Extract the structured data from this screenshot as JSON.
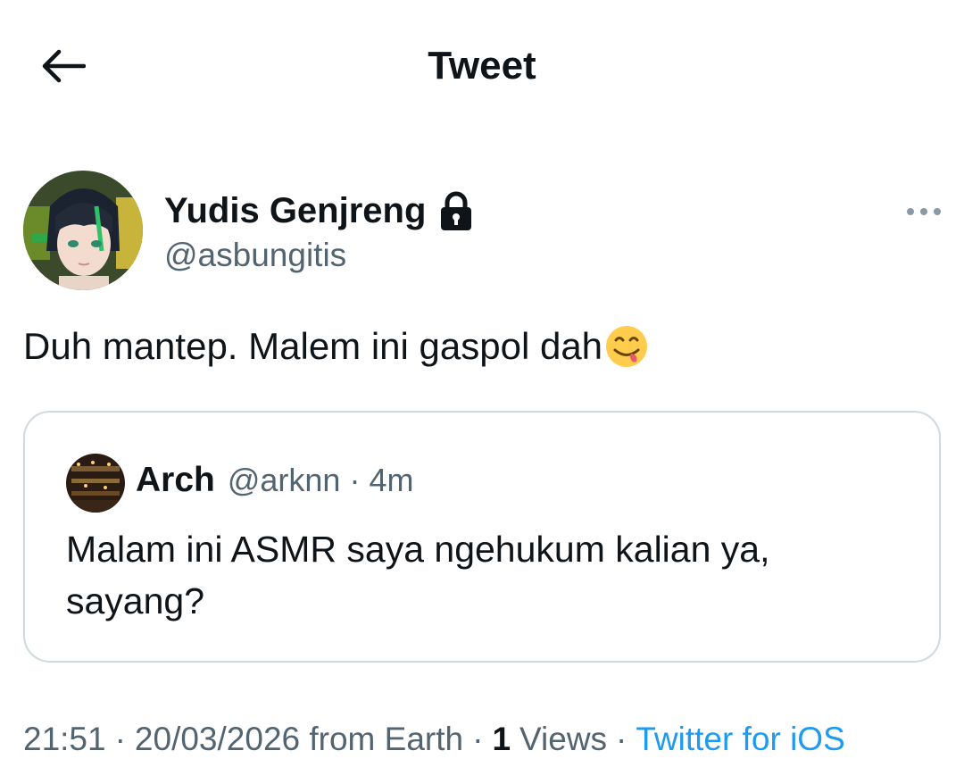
{
  "header": {
    "title": "Tweet",
    "back_icon": "arrow-left-icon"
  },
  "author": {
    "display_name": "Yudis Genjreng",
    "handle": "@asbungitis",
    "protected_icon": "lock-icon"
  },
  "more_icon": "more-horizontal-icon",
  "tweet": {
    "text": "Duh mantep. Malem ini gaspol dah",
    "emoji": "face-savoring-food-emoji"
  },
  "quote": {
    "name": "Arch",
    "handle": "@arknn",
    "separator": "·",
    "time": "4m",
    "text_line1": "Malam ini ASMR saya ngehukum kalian ya,",
    "text_line2": "sayang?"
  },
  "meta": {
    "time": "21:51",
    "date": "20/03/2026 from Earth",
    "views_count": "1",
    "views_label": "Views",
    "source": "Twitter for iOS",
    "separator": "·"
  },
  "colors": {
    "text_primary": "#0f1419",
    "text_secondary": "#536471",
    "accent": "#1d9bf0",
    "border": "#cfd9de"
  }
}
